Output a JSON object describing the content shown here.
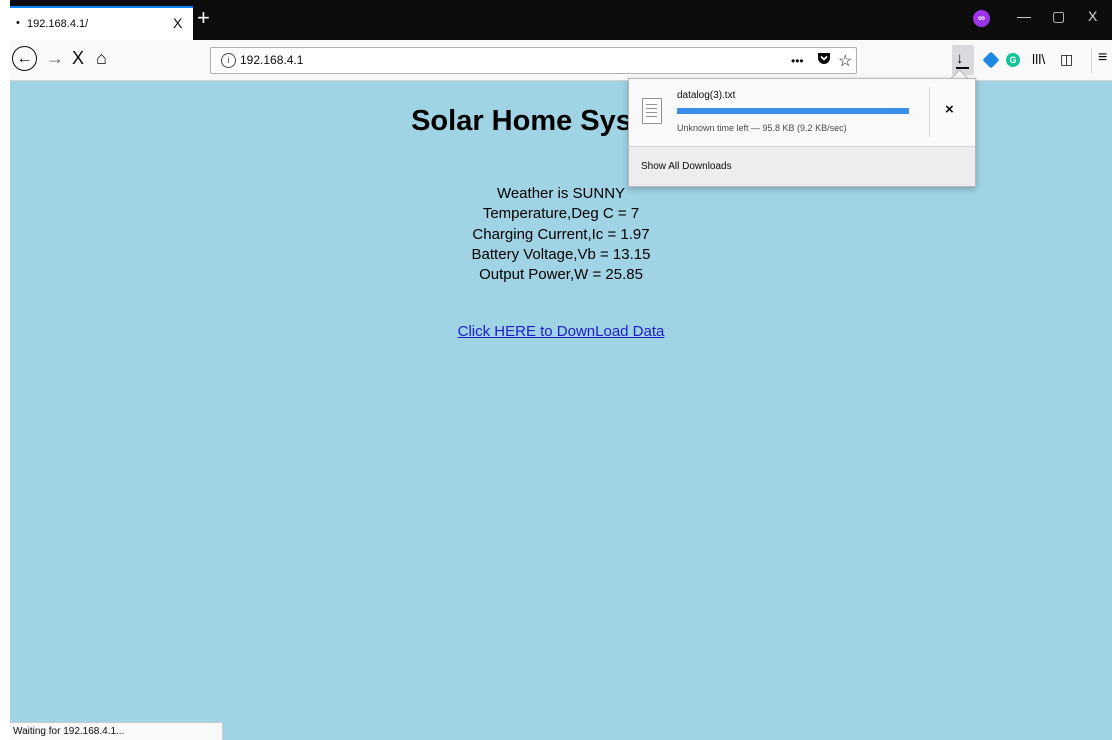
{
  "browser": {
    "tab": {
      "bullet": "•",
      "title": "192.168.4.1/",
      "close": "X"
    },
    "new_tab": "+",
    "window_controls": {
      "minimize": "—",
      "restore": "▢",
      "close": "X"
    },
    "nav": {
      "back": "←",
      "forward": "→",
      "stop": "X",
      "home": "⌂"
    },
    "url": "192.168.4.1",
    "url_actions": {
      "more": "•••",
      "pocket": "pocket-icon",
      "bookmark": "☆"
    },
    "toolbar": {
      "download": "↓",
      "library": "lll\\",
      "sidebar": "◫",
      "menu": "≡",
      "grammarly": "G"
    },
    "status": "Waiting for 192.168.4.1..."
  },
  "page": {
    "heading": "Solar Home System V",
    "readings": [
      "Weather is SUNNY",
      "Temperature,Deg C = 7",
      "Charging Current,Ic = 1.97",
      "Battery Voltage,Vb = 13.15",
      "Output Power,W = 25.85"
    ],
    "download_link": "Click HERE to DownLoad Data"
  },
  "downloads_panel": {
    "filename": "datalog(3).txt",
    "progress_fraction": 0.0,
    "progress_indeterminate": true,
    "status": "Unknown time left — 95.8 KB (9.2 KB/sec)",
    "cancel": "×",
    "show_all": "Show All Downloads"
  },
  "colors": {
    "page_background": "#a0d3e4",
    "link": "#1e1ec8",
    "progress": "#3a8de8",
    "accent": "#0a84ff"
  }
}
